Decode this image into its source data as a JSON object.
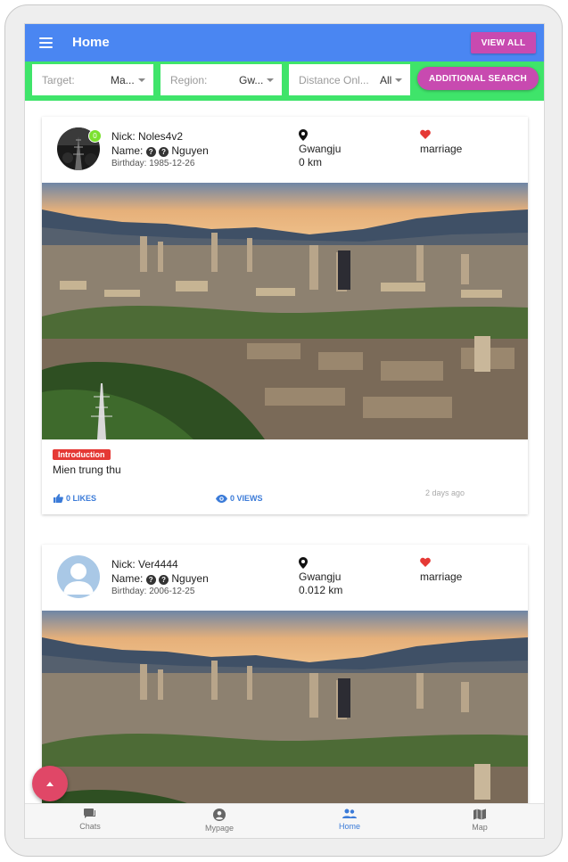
{
  "header": {
    "title": "Home",
    "view_all": "VIEW ALL"
  },
  "filters": {
    "target_label": "Target:",
    "target_value": "Ma...",
    "region_label": "Region:",
    "region_value": "Gw...",
    "distance_label": "Distance Onl...",
    "distance_value": "All",
    "additional_search": "ADDITIONAL SEARCH"
  },
  "posts": [
    {
      "badge": "0",
      "nick": "Nick: Noles4v2",
      "name_prefix": "Name:",
      "name": "Nguyen",
      "birthday": "Birthday: 1985-12-26",
      "city": "Gwangju",
      "distance": "0 km",
      "purpose": "marriage",
      "intro_label": "Introduction",
      "text": "Mien trung thu",
      "likes": "0 LIKES",
      "views": "0 VIEWS",
      "time": "2 days ago"
    },
    {
      "nick": "Nick: Ver4444",
      "name_prefix": "Name:",
      "name": "Nguyen",
      "birthday": "Birthday: 2006-12-25",
      "city": "Gwangju",
      "distance": "0.012 km",
      "purpose": "marriage"
    }
  ],
  "nav": {
    "chats": "Chats",
    "mypage": "Mypage",
    "home": "Home",
    "map": "Map"
  },
  "colors": {
    "appbar": "#4a86f2",
    "filterbar": "#3fe46a",
    "accent": "#c84ab0",
    "link": "#3b7bd8",
    "fab": "#e04767"
  }
}
